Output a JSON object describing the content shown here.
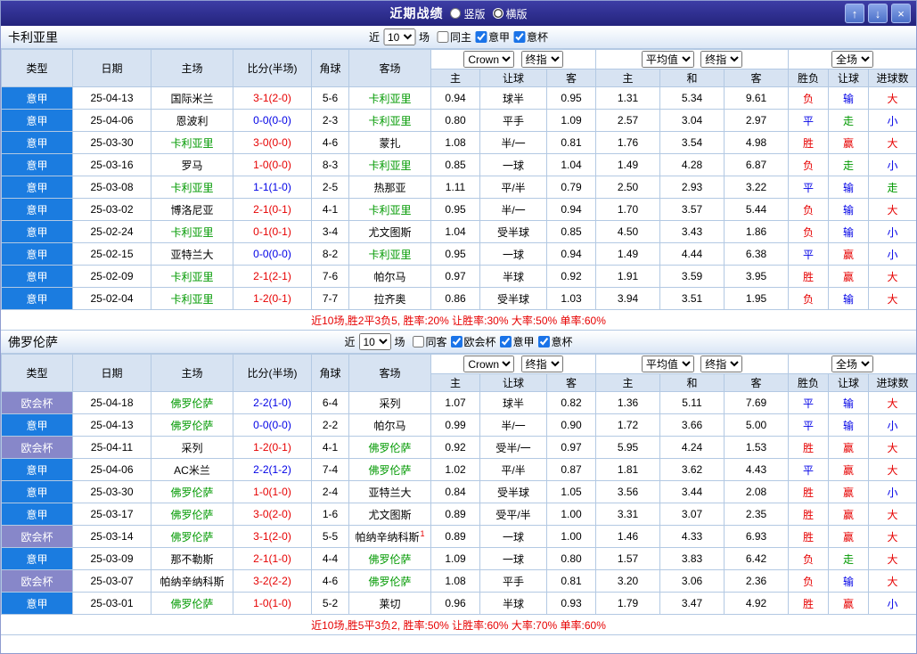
{
  "titlebar": {
    "title": "近期战绩",
    "layout_options": [
      {
        "label": "竖版",
        "selected": false
      },
      {
        "label": "横版",
        "selected": true
      }
    ],
    "buttons": {
      "up": "↑",
      "down": "↓",
      "close": "×"
    }
  },
  "table_headers": {
    "left": [
      "类型",
      "日期",
      "主场",
      "比分(半场)",
      "角球",
      "客场"
    ],
    "odds_sub": [
      "主",
      "让球",
      "客"
    ],
    "euro_sub": [
      "主",
      "和",
      "客"
    ],
    "result_sub": [
      "胜负",
      "让球",
      "进球数"
    ]
  },
  "sections": [
    {
      "team": "卡利亚里",
      "near_label": "近",
      "matches_label": "场",
      "recent_count": "10",
      "filters": [
        {
          "label": "同主",
          "checked": false
        },
        {
          "label": "意甲",
          "checked": true
        },
        {
          "label": "意杯",
          "checked": true
        }
      ],
      "selects": {
        "odds_source": "Crown",
        "odds_type": "终指",
        "euro_source": "平均值",
        "euro_type": "终指",
        "scope": "全场"
      },
      "rows": [
        {
          "league": "意甲",
          "league_color": "blue",
          "date": "25-04-13",
          "home": "国际米兰",
          "home_team": false,
          "score": "3-1(2-0)",
          "score_color": "red",
          "corners": "5-6",
          "away": "卡利亚里",
          "away_team": true,
          "odds": [
            "0.94",
            "球半",
            "0.95"
          ],
          "euro": [
            "1.31",
            "5.34",
            "9.61"
          ],
          "results": [
            {
              "text": "负",
              "color": "red"
            },
            {
              "text": "输",
              "color": "blue"
            },
            {
              "text": "大",
              "color": "red"
            }
          ]
        },
        {
          "league": "意甲",
          "league_color": "blue",
          "date": "25-04-06",
          "home": "恩波利",
          "home_team": false,
          "score": "0-0(0-0)",
          "score_color": "blue",
          "corners": "2-3",
          "away": "卡利亚里",
          "away_team": true,
          "odds": [
            "0.80",
            "平手",
            "1.09"
          ],
          "euro": [
            "2.57",
            "3.04",
            "2.97"
          ],
          "results": [
            {
              "text": "平",
              "color": "blue"
            },
            {
              "text": "走",
              "color": "green"
            },
            {
              "text": "小",
              "color": "blue"
            }
          ]
        },
        {
          "league": "意甲",
          "league_color": "blue",
          "date": "25-03-30",
          "home": "卡利亚里",
          "home_team": true,
          "score": "3-0(0-0)",
          "score_color": "red",
          "corners": "4-6",
          "away": "蒙扎",
          "away_team": false,
          "odds": [
            "1.08",
            "半/一",
            "0.81"
          ],
          "euro": [
            "1.76",
            "3.54",
            "4.98"
          ],
          "results": [
            {
              "text": "胜",
              "color": "red"
            },
            {
              "text": "赢",
              "color": "red"
            },
            {
              "text": "大",
              "color": "red"
            }
          ]
        },
        {
          "league": "意甲",
          "league_color": "blue",
          "date": "25-03-16",
          "home": "罗马",
          "home_team": false,
          "score": "1-0(0-0)",
          "score_color": "red",
          "corners": "8-3",
          "away": "卡利亚里",
          "away_team": true,
          "odds": [
            "0.85",
            "一球",
            "1.04"
          ],
          "euro": [
            "1.49",
            "4.28",
            "6.87"
          ],
          "results": [
            {
              "text": "负",
              "color": "red"
            },
            {
              "text": "走",
              "color": "green"
            },
            {
              "text": "小",
              "color": "blue"
            }
          ]
        },
        {
          "league": "意甲",
          "league_color": "blue",
          "date": "25-03-08",
          "home": "卡利亚里",
          "home_team": true,
          "score": "1-1(1-0)",
          "score_color": "blue",
          "corners": "2-5",
          "away": "热那亚",
          "away_team": false,
          "odds": [
            "1.11",
            "平/半",
            "0.79"
          ],
          "euro": [
            "2.50",
            "2.93",
            "3.22"
          ],
          "results": [
            {
              "text": "平",
              "color": "blue"
            },
            {
              "text": "输",
              "color": "blue"
            },
            {
              "text": "走",
              "color": "green"
            }
          ]
        },
        {
          "league": "意甲",
          "league_color": "blue",
          "date": "25-03-02",
          "home": "博洛尼亚",
          "home_team": false,
          "score": "2-1(0-1)",
          "score_color": "red",
          "corners": "4-1",
          "away": "卡利亚里",
          "away_team": true,
          "odds": [
            "0.95",
            "半/一",
            "0.94"
          ],
          "euro": [
            "1.70",
            "3.57",
            "5.44"
          ],
          "results": [
            {
              "text": "负",
              "color": "red"
            },
            {
              "text": "输",
              "color": "blue"
            },
            {
              "text": "大",
              "color": "red"
            }
          ]
        },
        {
          "league": "意甲",
          "league_color": "blue",
          "date": "25-02-24",
          "home": "卡利亚里",
          "home_team": true,
          "score": "0-1(0-1)",
          "score_color": "red",
          "corners": "3-4",
          "away": "尤文图斯",
          "away_team": false,
          "odds": [
            "1.04",
            "受半球",
            "0.85"
          ],
          "euro": [
            "4.50",
            "3.43",
            "1.86"
          ],
          "results": [
            {
              "text": "负",
              "color": "red"
            },
            {
              "text": "输",
              "color": "blue"
            },
            {
              "text": "小",
              "color": "blue"
            }
          ]
        },
        {
          "league": "意甲",
          "league_color": "blue",
          "date": "25-02-15",
          "home": "亚特兰大",
          "home_team": false,
          "score": "0-0(0-0)",
          "score_color": "blue",
          "corners": "8-2",
          "away": "卡利亚里",
          "away_team": true,
          "odds": [
            "0.95",
            "一球",
            "0.94"
          ],
          "euro": [
            "1.49",
            "4.44",
            "6.38"
          ],
          "results": [
            {
              "text": "平",
              "color": "blue"
            },
            {
              "text": "赢",
              "color": "red"
            },
            {
              "text": "小",
              "color": "blue"
            }
          ]
        },
        {
          "league": "意甲",
          "league_color": "blue",
          "date": "25-02-09",
          "home": "卡利亚里",
          "home_team": true,
          "score": "2-1(2-1)",
          "score_color": "red",
          "corners": "7-6",
          "away": "帕尔马",
          "away_team": false,
          "odds": [
            "0.97",
            "半球",
            "0.92"
          ],
          "euro": [
            "1.91",
            "3.59",
            "3.95"
          ],
          "results": [
            {
              "text": "胜",
              "color": "red"
            },
            {
              "text": "赢",
              "color": "red"
            },
            {
              "text": "大",
              "color": "red"
            }
          ]
        },
        {
          "league": "意甲",
          "league_color": "blue",
          "date": "25-02-04",
          "home": "卡利亚里",
          "home_team": true,
          "score": "1-2(0-1)",
          "score_color": "red",
          "corners": "7-7",
          "away": "拉齐奥",
          "away_team": false,
          "odds": [
            "0.86",
            "受半球",
            "1.03"
          ],
          "euro": [
            "3.94",
            "3.51",
            "1.95"
          ],
          "results": [
            {
              "text": "负",
              "color": "red"
            },
            {
              "text": "输",
              "color": "blue"
            },
            {
              "text": "大",
              "color": "red"
            }
          ]
        }
      ],
      "summary": "近10场,胜2平3负5, 胜率:20% 让胜率:30% 大率:50% 单率:60%"
    },
    {
      "team": "佛罗伦萨",
      "near_label": "近",
      "matches_label": "场",
      "recent_count": "10",
      "filters": [
        {
          "label": "同客",
          "checked": false
        },
        {
          "label": "欧会杯",
          "checked": true
        },
        {
          "label": "意甲",
          "checked": true
        },
        {
          "label": "意杯",
          "checked": true
        }
      ],
      "selects": {
        "odds_source": "Crown",
        "odds_type": "终指",
        "euro_source": "平均值",
        "euro_type": "终指",
        "scope": "全场"
      },
      "rows": [
        {
          "league": "欧会杯",
          "league_color": "purple",
          "date": "25-04-18",
          "home": "佛罗伦萨",
          "home_team": true,
          "score": "2-2(1-0)",
          "score_color": "blue",
          "corners": "6-4",
          "away": "采列",
          "away_team": false,
          "odds": [
            "1.07",
            "球半",
            "0.82"
          ],
          "euro": [
            "1.36",
            "5.11",
            "7.69"
          ],
          "results": [
            {
              "text": "平",
              "color": "blue"
            },
            {
              "text": "输",
              "color": "blue"
            },
            {
              "text": "大",
              "color": "red"
            }
          ]
        },
        {
          "league": "意甲",
          "league_color": "blue",
          "date": "25-04-13",
          "home": "佛罗伦萨",
          "home_team": true,
          "score": "0-0(0-0)",
          "score_color": "blue",
          "corners": "2-2",
          "away": "帕尔马",
          "away_team": false,
          "odds": [
            "0.99",
            "半/一",
            "0.90"
          ],
          "euro": [
            "1.72",
            "3.66",
            "5.00"
          ],
          "results": [
            {
              "text": "平",
              "color": "blue"
            },
            {
              "text": "输",
              "color": "blue"
            },
            {
              "text": "小",
              "color": "blue"
            }
          ]
        },
        {
          "league": "欧会杯",
          "league_color": "purple",
          "date": "25-04-11",
          "home": "采列",
          "home_team": false,
          "score": "1-2(0-1)",
          "score_color": "red",
          "corners": "4-1",
          "away": "佛罗伦萨",
          "away_team": true,
          "odds": [
            "0.92",
            "受半/一",
            "0.97"
          ],
          "euro": [
            "5.95",
            "4.24",
            "1.53"
          ],
          "results": [
            {
              "text": "胜",
              "color": "red"
            },
            {
              "text": "赢",
              "color": "red"
            },
            {
              "text": "大",
              "color": "red"
            }
          ]
        },
        {
          "league": "意甲",
          "league_color": "blue",
          "date": "25-04-06",
          "home": "AC米兰",
          "home_team": false,
          "score": "2-2(1-2)",
          "score_color": "blue",
          "corners": "7-4",
          "away": "佛罗伦萨",
          "away_team": true,
          "odds": [
            "1.02",
            "平/半",
            "0.87"
          ],
          "euro": [
            "1.81",
            "3.62",
            "4.43"
          ],
          "results": [
            {
              "text": "平",
              "color": "blue"
            },
            {
              "text": "赢",
              "color": "red"
            },
            {
              "text": "大",
              "color": "red"
            }
          ]
        },
        {
          "league": "意甲",
          "league_color": "blue",
          "date": "25-03-30",
          "home": "佛罗伦萨",
          "home_team": true,
          "score": "1-0(1-0)",
          "score_color": "red",
          "corners": "2-4",
          "away": "亚特兰大",
          "away_team": false,
          "odds": [
            "0.84",
            "受半球",
            "1.05"
          ],
          "euro": [
            "3.56",
            "3.44",
            "2.08"
          ],
          "results": [
            {
              "text": "胜",
              "color": "red"
            },
            {
              "text": "赢",
              "color": "red"
            },
            {
              "text": "小",
              "color": "blue"
            }
          ]
        },
        {
          "league": "意甲",
          "league_color": "blue",
          "date": "25-03-17",
          "home": "佛罗伦萨",
          "home_team": true,
          "score": "3-0(2-0)",
          "score_color": "red",
          "corners": "1-6",
          "away": "尤文图斯",
          "away_team": false,
          "odds": [
            "0.89",
            "受平/半",
            "1.00"
          ],
          "euro": [
            "3.31",
            "3.07",
            "2.35"
          ],
          "results": [
            {
              "text": "胜",
              "color": "red"
            },
            {
              "text": "赢",
              "color": "red"
            },
            {
              "text": "大",
              "color": "red"
            }
          ]
        },
        {
          "league": "欧会杯",
          "league_color": "purple",
          "date": "25-03-14",
          "home": "佛罗伦萨",
          "home_team": true,
          "score": "3-1(2-0)",
          "score_color": "red",
          "corners": "5-5",
          "away": "帕纳辛纳科斯",
          "away_team": false,
          "away_sup": "1",
          "odds": [
            "0.89",
            "一球",
            "1.00"
          ],
          "euro": [
            "1.46",
            "4.33",
            "6.93"
          ],
          "results": [
            {
              "text": "胜",
              "color": "red"
            },
            {
              "text": "赢",
              "color": "red"
            },
            {
              "text": "大",
              "color": "red"
            }
          ]
        },
        {
          "league": "意甲",
          "league_color": "blue",
          "date": "25-03-09",
          "home": "那不勒斯",
          "home_team": false,
          "score": "2-1(1-0)",
          "score_color": "red",
          "corners": "4-4",
          "away": "佛罗伦萨",
          "away_team": true,
          "odds": [
            "1.09",
            "一球",
            "0.80"
          ],
          "euro": [
            "1.57",
            "3.83",
            "6.42"
          ],
          "results": [
            {
              "text": "负",
              "color": "red"
            },
            {
              "text": "走",
              "color": "green"
            },
            {
              "text": "大",
              "color": "red"
            }
          ]
        },
        {
          "league": "欧会杯",
          "league_color": "purple",
          "date": "25-03-07",
          "home": "帕纳辛纳科斯",
          "home_team": false,
          "score": "3-2(2-2)",
          "score_color": "red",
          "corners": "4-6",
          "away": "佛罗伦萨",
          "away_team": true,
          "odds": [
            "1.08",
            "平手",
            "0.81"
          ],
          "euro": [
            "3.20",
            "3.06",
            "2.36"
          ],
          "results": [
            {
              "text": "负",
              "color": "red"
            },
            {
              "text": "输",
              "color": "blue"
            },
            {
              "text": "大",
              "color": "red"
            }
          ]
        },
        {
          "league": "意甲",
          "league_color": "blue",
          "date": "25-03-01",
          "home": "佛罗伦萨",
          "home_team": true,
          "score": "1-0(1-0)",
          "score_color": "red",
          "corners": "5-2",
          "away": "莱切",
          "away_team": false,
          "odds": [
            "0.96",
            "半球",
            "0.93"
          ],
          "euro": [
            "1.79",
            "3.47",
            "4.92"
          ],
          "results": [
            {
              "text": "胜",
              "color": "red"
            },
            {
              "text": "赢",
              "color": "red"
            },
            {
              "text": "小",
              "color": "blue"
            }
          ]
        }
      ],
      "summary": "近10场,胜5平3负2, 胜率:50% 让胜率:60% 大率:70% 单率:60%"
    }
  ]
}
